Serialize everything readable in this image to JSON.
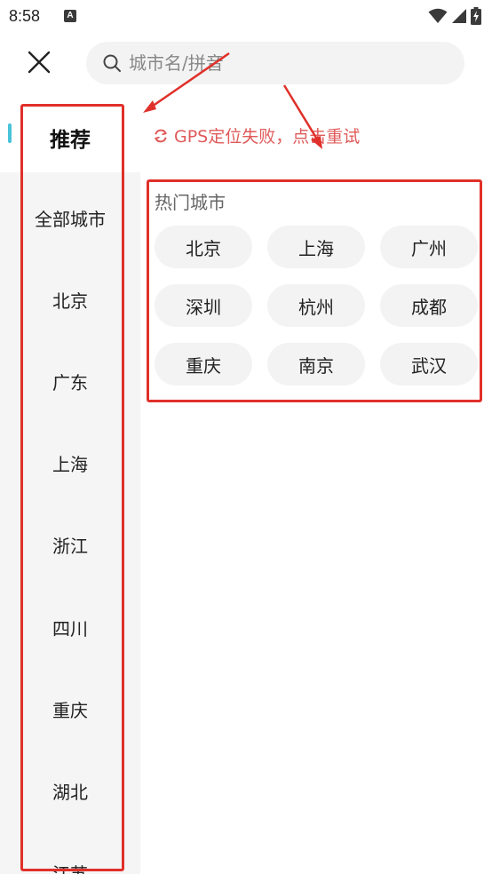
{
  "status_bar": {
    "time": "8:58",
    "notification_letter": "A"
  },
  "search": {
    "placeholder": "城市名/拼音"
  },
  "sidebar": {
    "items": [
      {
        "label": "推荐",
        "active": true
      },
      {
        "label": "全部城市",
        "active": false
      },
      {
        "label": "北京",
        "active": false
      },
      {
        "label": "广东",
        "active": false
      },
      {
        "label": "上海",
        "active": false
      },
      {
        "label": "浙江",
        "active": false
      },
      {
        "label": "四川",
        "active": false
      },
      {
        "label": "重庆",
        "active": false
      },
      {
        "label": "湖北",
        "active": false
      },
      {
        "label": "江苏",
        "active": false
      }
    ]
  },
  "gps": {
    "message": "GPS定位失败，点击重试",
    "color": "#e05a5a"
  },
  "hot_cities": {
    "title": "热门城市",
    "cities": [
      "北京",
      "上海",
      "广州",
      "深圳",
      "杭州",
      "成都",
      "重庆",
      "南京",
      "武汉"
    ]
  },
  "colors": {
    "accent": "#49c3d9",
    "annotation": "#e0302a"
  },
  "icons": {
    "close": "close-icon",
    "search": "search-icon",
    "refresh": "refresh-icon",
    "wifi": "wifi-icon",
    "signal": "signal-icon",
    "battery": "battery-charging-icon"
  }
}
